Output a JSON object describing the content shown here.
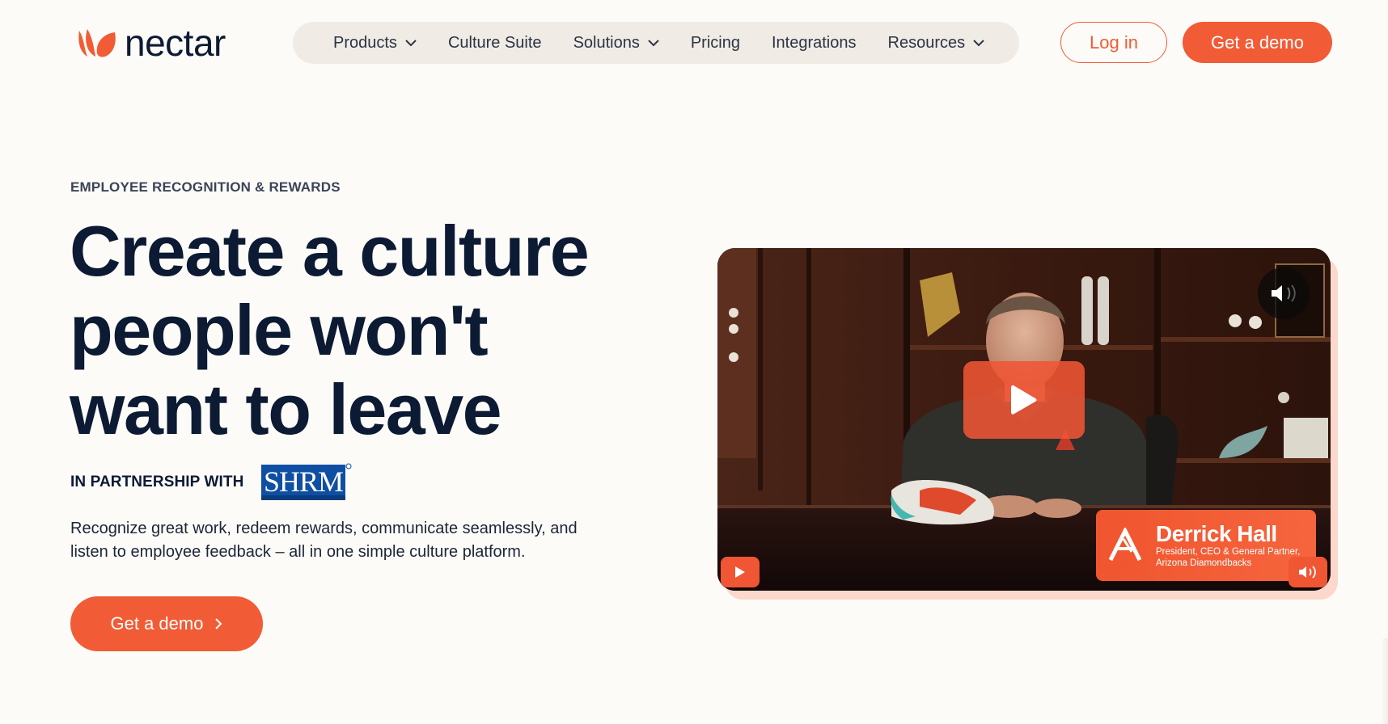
{
  "header": {
    "logo_text": "nectar",
    "nav": [
      {
        "label": "Products",
        "has_dropdown": true
      },
      {
        "label": "Culture Suite",
        "has_dropdown": false
      },
      {
        "label": "Solutions",
        "has_dropdown": true
      },
      {
        "label": "Pricing",
        "has_dropdown": false
      },
      {
        "label": "Integrations",
        "has_dropdown": false
      },
      {
        "label": "Resources",
        "has_dropdown": true
      }
    ],
    "login_label": "Log in",
    "demo_label": "Get a demo"
  },
  "hero": {
    "eyebrow": "EMPLOYEE RECOGNITION & REWARDS",
    "headline_lines": [
      "Create a culture",
      "people won't",
      "want to leave"
    ],
    "partner_label": "IN PARTNERSHIP WITH",
    "partner_logo_text": "SHRM",
    "description": "Recognize great work, redeem rewards, communicate seamlessly, and listen to employee feedback – all in one simple culture platform.",
    "cta_label": "Get a demo"
  },
  "video": {
    "speaker_name": "Derrick Hall",
    "speaker_role_line1": "President, CEO & General Partner,",
    "speaker_role_line2": "Arizona Diamondbacks",
    "icons": [
      "play-icon",
      "mute-icon",
      "volume-icon",
      "diamondbacks-logo"
    ]
  },
  "colors": {
    "brand": "#f15b35",
    "text_dark": "#0c1a33",
    "background": "#fcfbf8",
    "nav_pill": "#f0ebe4"
  }
}
